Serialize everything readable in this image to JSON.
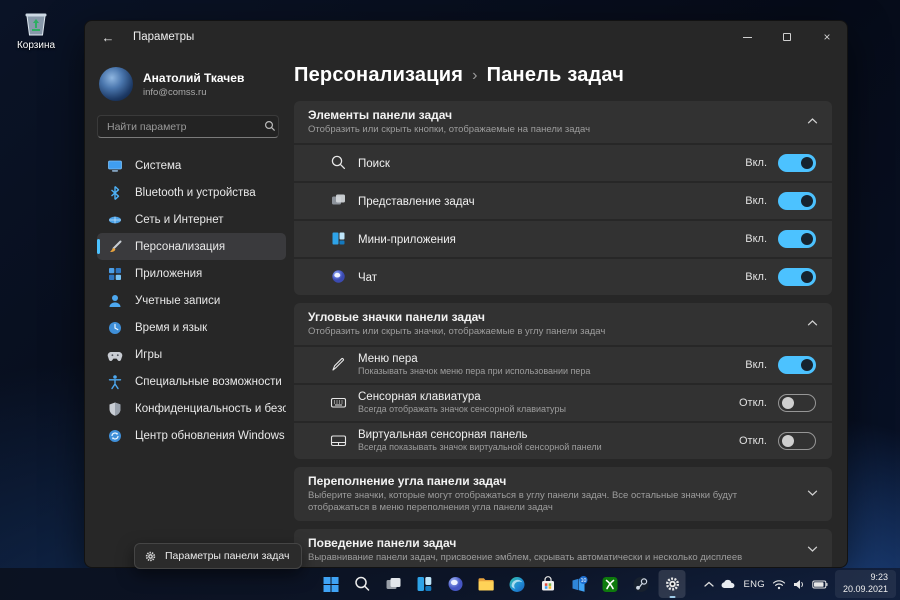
{
  "desktop": {
    "recycle_bin_label": "Корзина"
  },
  "window": {
    "titlebar": {
      "title": "Параметры"
    },
    "profile": {
      "name": "Анатолий Ткачев",
      "email": "info@comss.ru"
    },
    "search": {
      "placeholder": "Найти параметр"
    },
    "sidebar": {
      "selected_index": 3,
      "items": [
        {
          "label": "Система",
          "icon": "system-icon"
        },
        {
          "label": "Bluetooth и устройства",
          "icon": "bluetooth-icon"
        },
        {
          "label": "Сеть и Интернет",
          "icon": "network-icon"
        },
        {
          "label": "Персонализация",
          "icon": "personalization-icon"
        },
        {
          "label": "Приложения",
          "icon": "apps-icon"
        },
        {
          "label": "Учетные записи",
          "icon": "accounts-icon"
        },
        {
          "label": "Время и язык",
          "icon": "time-language-icon"
        },
        {
          "label": "Игры",
          "icon": "games-icon"
        },
        {
          "label": "Специальные возможности",
          "icon": "accessibility-icon"
        },
        {
          "label": "Конфиденциальность и безопас",
          "icon": "privacy-icon"
        },
        {
          "label": "Центр обновления Windows",
          "icon": "windows-update-icon"
        }
      ]
    }
  },
  "main": {
    "breadcrumb": {
      "parent": "Персонализация",
      "separator": "›",
      "current": "Панель задач"
    },
    "sections": [
      {
        "title": "Элементы панели задач",
        "subtitle": "Отобразить или скрыть кнопки, отображаемые на панели задач",
        "expanded": true,
        "rows": [
          {
            "label": "Поиск",
            "state": "Вкл.",
            "icon": "search-icon"
          },
          {
            "label": "Представление задач",
            "state": "Вкл.",
            "icon": "task-view-icon"
          },
          {
            "label": "Мини-приложения",
            "state": "Вкл.",
            "icon": "widgets-icon"
          },
          {
            "label": "Чат",
            "state": "Вкл.",
            "icon": "chat-icon"
          }
        ]
      },
      {
        "title": "Угловые значки панели задач",
        "subtitle": "Отобразить или скрыть значки, отображаемые в углу панели задач",
        "expanded": true,
        "rows": [
          {
            "label": "Меню пера",
            "desc": "Показывать значок меню пера при использовании пера",
            "state": "Вкл.",
            "icon": "pen-icon"
          },
          {
            "label": "Сенсорная клавиатура",
            "desc": "Всегда отображать значок сенсорной клавиатуры",
            "state": "Откл.",
            "icon": "touch-keyboard-icon"
          },
          {
            "label": "Виртуальная сенсорная панель",
            "desc": "Всегда показывать значок виртуальной сенсорной панели",
            "state": "Откл.",
            "icon": "touchpad-icon"
          }
        ]
      },
      {
        "title": "Переполнение угла панели задач",
        "subtitle": "Выберите значки, которые могут отображаться в углу панели задач. Все остальные значки будут отображаться в меню переполнения угла панели задач",
        "expanded": false
      },
      {
        "title": "Поведение панели задач",
        "subtitle": "Выравнивание панели задач, присвоение эмблем, скрывать автоматически и несколько дисплеев",
        "expanded": false
      }
    ]
  },
  "context_menu": {
    "label": "Параметры панели задач",
    "icon": "gear-icon"
  },
  "taskbar": {
    "icons": [
      "start",
      "search",
      "task-view",
      "widgets",
      "chat",
      "file-explorer",
      "edge",
      "store",
      "windows-10",
      "xbox",
      "steam",
      "settings"
    ],
    "active_icon": "settings",
    "win10_badge": "10",
    "tray": {
      "language": "ENG",
      "time": "9:23",
      "date": "20.09.2021"
    }
  },
  "colors": {
    "accent": "#4cc2ff",
    "toggle_on": "#4cc2ff",
    "window_bg": "#272727",
    "card_bg": "#323232"
  }
}
